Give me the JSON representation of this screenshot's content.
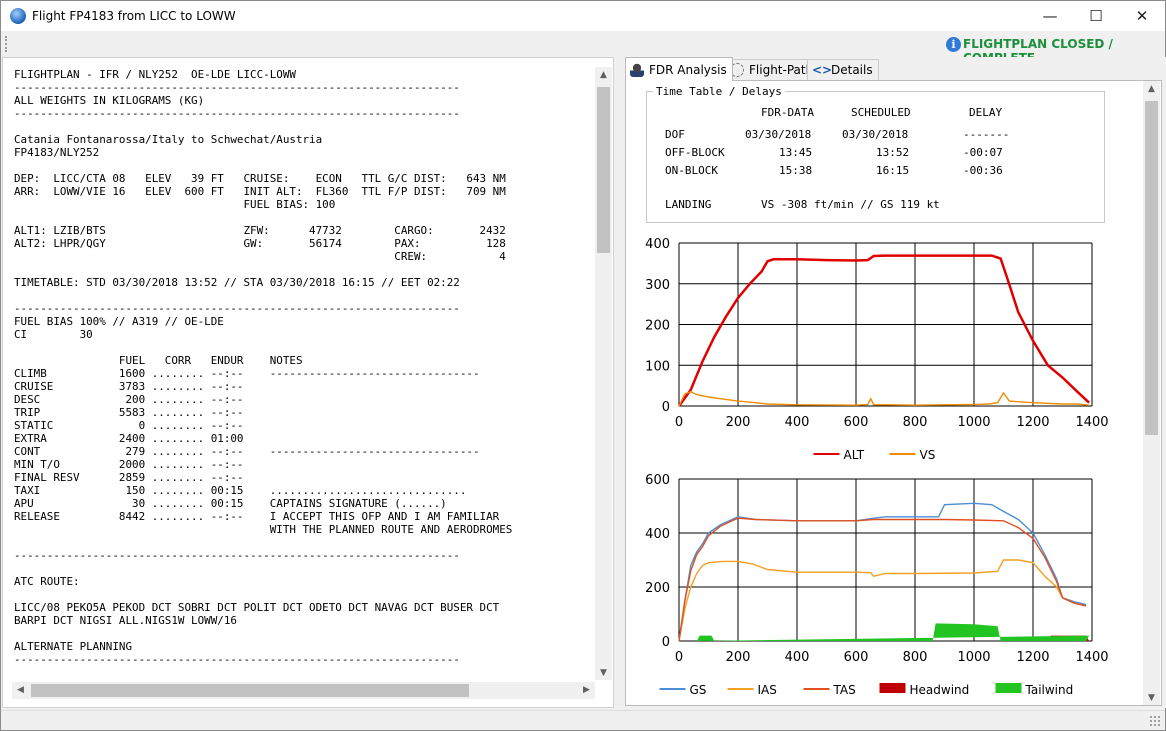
{
  "window": {
    "title": "Flight FP4183 from LICC to LOWW",
    "minimize": "—",
    "maximize": "☐",
    "close": "✕"
  },
  "status": {
    "text": "FLIGHTPLAN CLOSED / COMPLETE",
    "icon": "info-icon",
    "color": "#1b8f3a"
  },
  "ofp_text": "FLIGHTPLAN - IFR / NLY252  OE-LDE LICC-LOWW\n--------------------------------------------------------------------\nALL WEIGHTS IN KILOGRAMS (KG)\n--------------------------------------------------------------------\n\nCatania Fontanarossa/Italy to Schwechat/Austria\nFP4183/NLY252\n\nDEP:  LICC/CTA 08   ELEV   39 FT   CRUISE:    ECON   TTL G/C DIST:   643 NM\nARR:  LOWW/VIE 16   ELEV  600 FT   INIT ALT:  FL360  TTL F/P DIST:   709 NM\n                                   FUEL BIAS: 100\n\nALT1: LZIB/BTS                     ZFW:      47732        CARGO:       2432\nALT2: LHPR/QGY                     GW:       56174        PAX:          128\n                                                          CREW:           4\n\nTIMETABLE: STD 03/30/2018 13:52 // STA 03/30/2018 16:15 // EET 02:22\n\n--------------------------------------------------------------------\nFUEL BIAS 100% // A319 // OE-LDE\nCI        30\n\n                FUEL   CORR   ENDUR    NOTES\nCLIMB           1600 ........ --:--    --------------------------------\nCRUISE          3783 ........ --:--\nDESC             200 ........ --:--\nTRIP            5583 ........ --:--\nSTATIC             0 ........ --:--\nEXTRA           2400 ........ 01:00\nCONT             279 ........ --:--    --------------------------------\nMIN T/O         2000 ........ --:--\nFINAL RESV      2859 ........ --:--\nTAXI             150 ........ 00:15    ..............................\nAPU               30 ........ 00:15    CAPTAINS SIGNATURE (......)\nRELEASE         8442 ........ --:--    I ACCEPT THIS OFP AND I AM FAMILIAR\n                                       WITH THE PLANNED ROUTE AND AERODROMES\n\n--------------------------------------------------------------------\n\nATC ROUTE:\n\nLICC/08 PEKO5A PEKOD DCT SOBRI DCT POLIT DCT ODETO DCT NAVAG DCT BUSER DCT\nBARPI DCT NIGSI ALL.NIGS1W LOWW/16\n\nALTERNATE PLANNING\n--------------------------------------------------------------------",
  "tabs": [
    {
      "label": "FDR Analysis",
      "icon": "pilot-icon"
    },
    {
      "label": "Flight-Path",
      "icon": "route-icon"
    },
    {
      "label": "Details",
      "icon": "code-icon"
    }
  ],
  "timetable": {
    "legend": "Time Table / Delays",
    "headers": [
      "FDR-DATA",
      "SCHEDULED",
      "DELAY"
    ],
    "rows": [
      {
        "label": "DOF",
        "fdr": "03/30/2018",
        "sched": "03/30/2018",
        "delay": "-------"
      },
      {
        "label": "OFF-BLOCK",
        "fdr": "13:45",
        "sched": "13:52",
        "delay": "-00:07"
      },
      {
        "label": "ON-BLOCK",
        "fdr": "15:38",
        "sched": "16:15",
        "delay": "-00:36"
      }
    ],
    "landing_label": "LANDING",
    "landing_value": "VS -308 ft/min // GS 119 kt"
  },
  "chart_data": [
    {
      "type": "line",
      "xlim": [
        0,
        1400
      ],
      "ylim": [
        0,
        400
      ],
      "xticks": [
        "0",
        "200",
        "400",
        "600",
        "800",
        "1000",
        "1200",
        "1400"
      ],
      "yticks": [
        "0",
        "100",
        "200",
        "300",
        "400"
      ],
      "grid": true,
      "legend": "bottom",
      "series": [
        {
          "name": "ALT",
          "color": "#e00000",
          "x": [
            0,
            40,
            80,
            120,
            160,
            200,
            240,
            280,
            300,
            320,
            400,
            500,
            600,
            640,
            660,
            700,
            800,
            900,
            1000,
            1060,
            1090,
            1110,
            1150,
            1200,
            1250,
            1300,
            1350,
            1390
          ],
          "y": [
            0,
            40,
            110,
            170,
            220,
            265,
            300,
            330,
            355,
            360,
            360,
            358,
            357,
            358,
            368,
            369,
            369,
            369,
            369,
            369,
            362,
            320,
            230,
            160,
            100,
            70,
            35,
            8
          ]
        },
        {
          "name": "VS",
          "color": "#f08c00",
          "x": [
            0,
            20,
            40,
            60,
            100,
            140,
            200,
            260,
            300,
            400,
            600,
            640,
            650,
            660,
            700,
            800,
            900,
            1000,
            1050,
            1080,
            1100,
            1120,
            1200,
            1300,
            1350,
            1390
          ],
          "y": [
            0,
            30,
            35,
            28,
            22,
            18,
            12,
            8,
            5,
            3,
            2,
            4,
            18,
            3,
            3,
            2,
            3,
            4,
            5,
            8,
            32,
            12,
            8,
            5,
            5,
            2
          ]
        }
      ]
    },
    {
      "type": "line",
      "xlim": [
        0,
        1400
      ],
      "ylim": [
        0,
        600
      ],
      "xticks": [
        "0",
        "200",
        "400",
        "600",
        "800",
        "1000",
        "1200",
        "1400"
      ],
      "yticks": [
        "0",
        "200",
        "400",
        "600"
      ],
      "grid": true,
      "legend": "bottom",
      "series": [
        {
          "name": "GS",
          "color": "#4a8fd4",
          "x": [
            0,
            20,
            40,
            60,
            80,
            100,
            140,
            180,
            200,
            260,
            400,
            600,
            660,
            700,
            800,
            880,
            900,
            1000,
            1060,
            1100,
            1150,
            1200,
            1240,
            1280,
            1300,
            1340,
            1380
          ],
          "y": [
            0,
            150,
            280,
            330,
            360,
            400,
            430,
            450,
            460,
            450,
            445,
            445,
            455,
            460,
            460,
            460,
            505,
            510,
            505,
            480,
            450,
            400,
            320,
            230,
            160,
            145,
            135
          ]
        },
        {
          "name": "IAS",
          "color": "#f4a020",
          "x": [
            0,
            20,
            40,
            60,
            80,
            100,
            150,
            200,
            250,
            300,
            400,
            600,
            650,
            660,
            700,
            800,
            1000,
            1080,
            1100,
            1150,
            1200,
            1240,
            1280,
            1300,
            1340,
            1380
          ],
          "y": [
            0,
            120,
            200,
            250,
            280,
            290,
            295,
            295,
            285,
            265,
            255,
            255,
            253,
            240,
            250,
            250,
            252,
            258,
            300,
            300,
            290,
            240,
            200,
            160,
            140,
            130
          ]
        },
        {
          "name": "TAS",
          "color": "#e05020",
          "x": [
            0,
            20,
            40,
            60,
            80,
            100,
            140,
            180,
            200,
            260,
            400,
            600,
            660,
            700,
            800,
            880,
            900,
            1000,
            1100,
            1150,
            1200,
            1240,
            1280,
            1300,
            1340,
            1380
          ],
          "y": [
            0,
            150,
            260,
            320,
            350,
            390,
            425,
            445,
            455,
            450,
            445,
            445,
            450,
            450,
            450,
            450,
            450,
            448,
            445,
            420,
            380,
            310,
            220,
            160,
            140,
            130
          ]
        },
        {
          "name": "Headwind",
          "color": "#c00000",
          "type": "area",
          "x": [
            1250,
            1260,
            1380,
            1390
          ],
          "y": [
            0,
            20,
            20,
            0
          ]
        },
        {
          "name": "Tailwind",
          "color": "#22c422",
          "type": "area",
          "x": [
            60,
            70,
            110,
            120,
            860,
            870,
            1000,
            1080,
            1090,
            1380,
            1390,
            1400
          ],
          "y": [
            0,
            20,
            20,
            0,
            0,
            65,
            62,
            55,
            0,
            0,
            20,
            20
          ]
        }
      ]
    }
  ]
}
